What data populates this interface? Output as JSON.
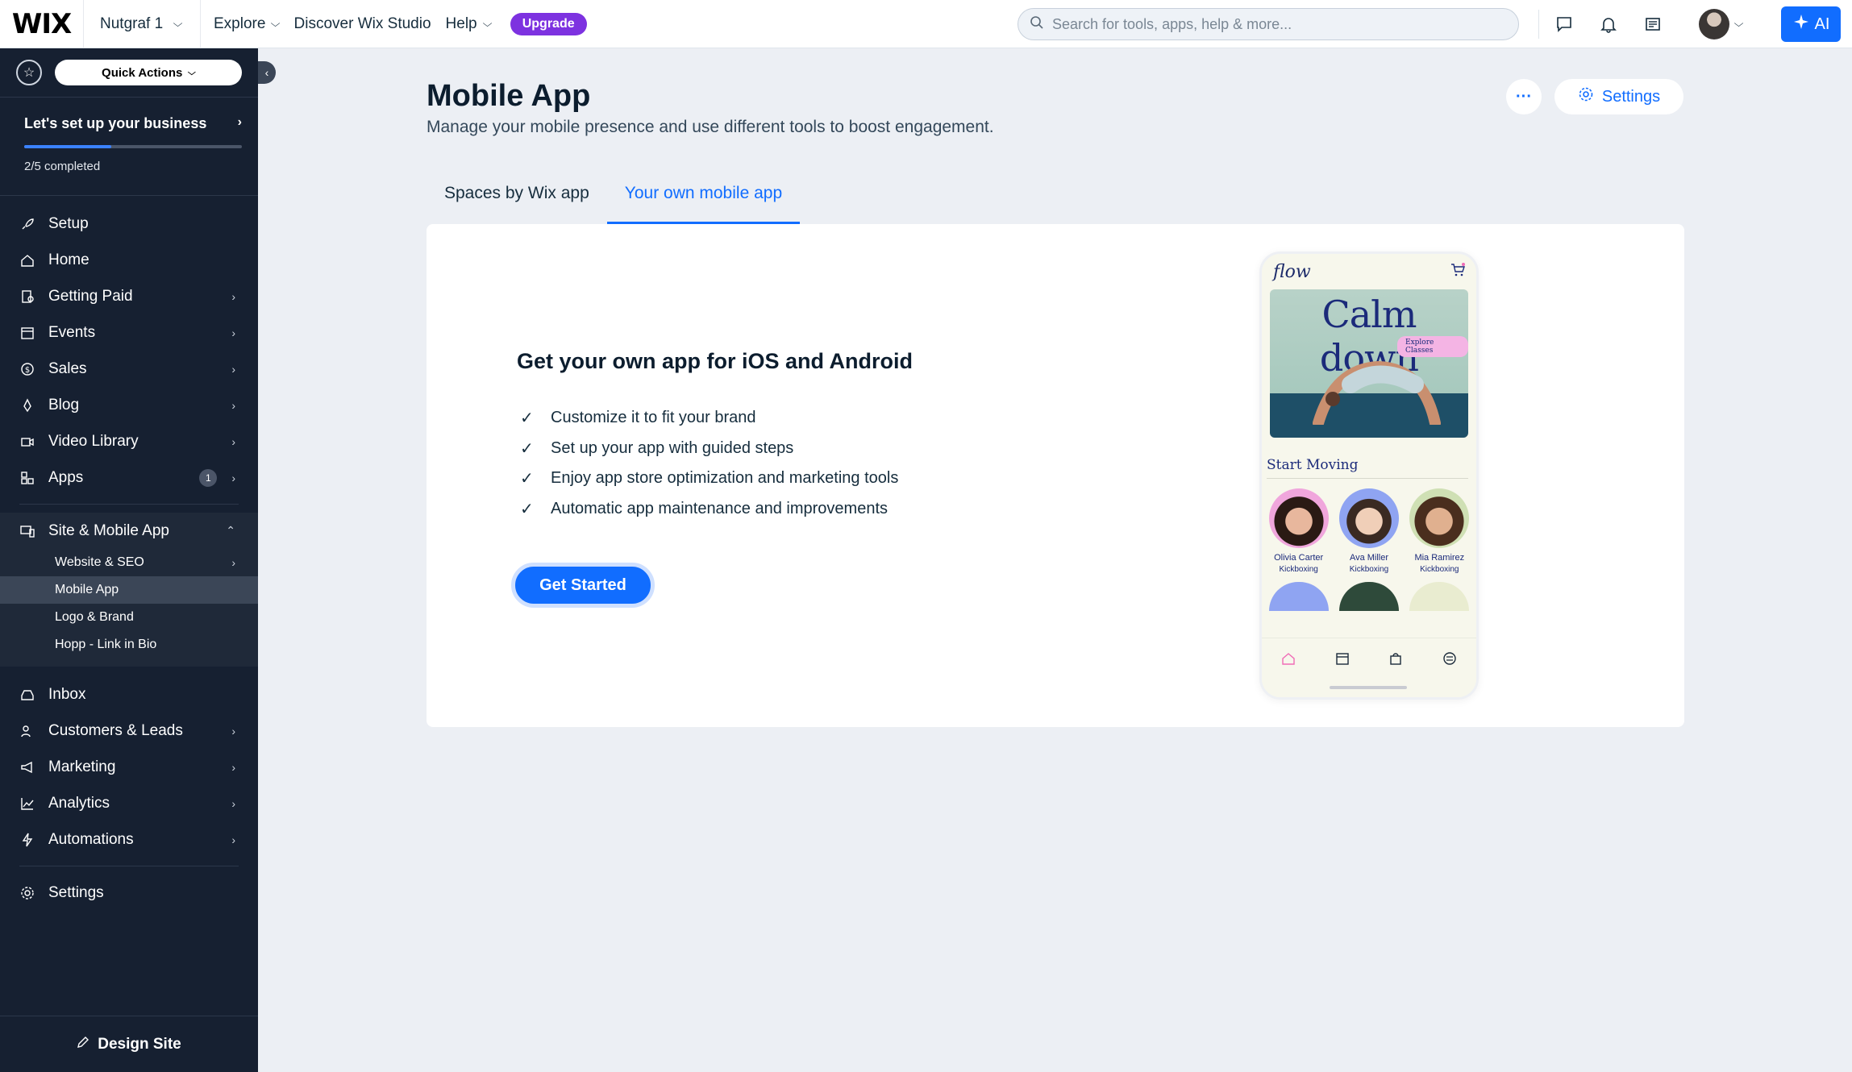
{
  "topbar": {
    "logo": "WIX",
    "site_name": "Nutgraf 1",
    "nav": [
      "Explore",
      "Discover Wix Studio",
      "Help"
    ],
    "upgrade_label": "Upgrade",
    "search_placeholder": "Search for tools, apps, help & more...",
    "ai_label": "AI",
    "icons": [
      "chat-icon",
      "bell-icon",
      "newsfeed-icon"
    ]
  },
  "sidebar": {
    "quick_actions_label": "Quick Actions",
    "setup_card": {
      "title": "Let's set up your business",
      "progress_text": "2/5 completed",
      "progress_fraction": 0.4
    },
    "items": [
      {
        "label": "Setup",
        "icon": "rocket-icon",
        "arrow": false
      },
      {
        "label": "Home",
        "icon": "home-icon",
        "arrow": false
      },
      {
        "label": "Getting Paid",
        "icon": "payment-icon",
        "arrow": true
      },
      {
        "label": "Events",
        "icon": "calendar-icon",
        "arrow": true
      },
      {
        "label": "Sales",
        "icon": "dollar-icon",
        "arrow": true
      },
      {
        "label": "Blog",
        "icon": "pen-nib-icon",
        "arrow": true
      },
      {
        "label": "Video Library",
        "icon": "video-icon",
        "arrow": true
      },
      {
        "label": "Apps",
        "icon": "apps-icon",
        "arrow": true,
        "badge": "1"
      }
    ],
    "site_group": {
      "label": "Site & Mobile App",
      "subitems": [
        {
          "label": "Website & SEO",
          "arrow": true
        },
        {
          "label": "Mobile App",
          "active": true
        },
        {
          "label": "Logo & Brand"
        },
        {
          "label": "Hopp - Link in Bio"
        }
      ]
    },
    "items2": [
      {
        "label": "Inbox",
        "icon": "inbox-icon",
        "arrow": false
      },
      {
        "label": "Customers & Leads",
        "icon": "customers-icon",
        "arrow": true
      },
      {
        "label": "Marketing",
        "icon": "megaphone-icon",
        "arrow": true
      },
      {
        "label": "Analytics",
        "icon": "chart-icon",
        "arrow": true
      },
      {
        "label": "Automations",
        "icon": "lightning-icon",
        "arrow": true
      }
    ],
    "settings_label": "Settings",
    "design_site_label": "Design Site"
  },
  "main": {
    "title": "Mobile App",
    "subtitle": "Manage your mobile presence and use different tools to boost engagement.",
    "more_label": "···",
    "settings_label": "Settings",
    "tabs": [
      {
        "label": "Spaces by Wix app",
        "active": false
      },
      {
        "label": "Your own mobile app",
        "active": true
      }
    ],
    "card": {
      "title": "Get your own app for iOS and Android",
      "checklist": [
        "Customize it to fit your brand",
        "Set up your app with guided steps",
        "Enjoy app store optimization and marketing tools",
        "Automatic app maintenance and improvements"
      ],
      "cta_label": "Get Started"
    },
    "phone": {
      "logo": "flow",
      "hero_title": "Calm down",
      "hero_button": "Explore Classes",
      "section": "Start Moving",
      "people": [
        {
          "name": "Olivia Carter",
          "role": "Kickboxing"
        },
        {
          "name": "Ava Miller",
          "role": "Kickboxing"
        },
        {
          "name": "Mia Ramirez",
          "role": "Kickboxing"
        }
      ]
    }
  },
  "colors": {
    "accent": "#116dff",
    "sidebar_bg": "#162031",
    "upgrade": "#7d32e0",
    "page_bg": "#eceff4"
  }
}
